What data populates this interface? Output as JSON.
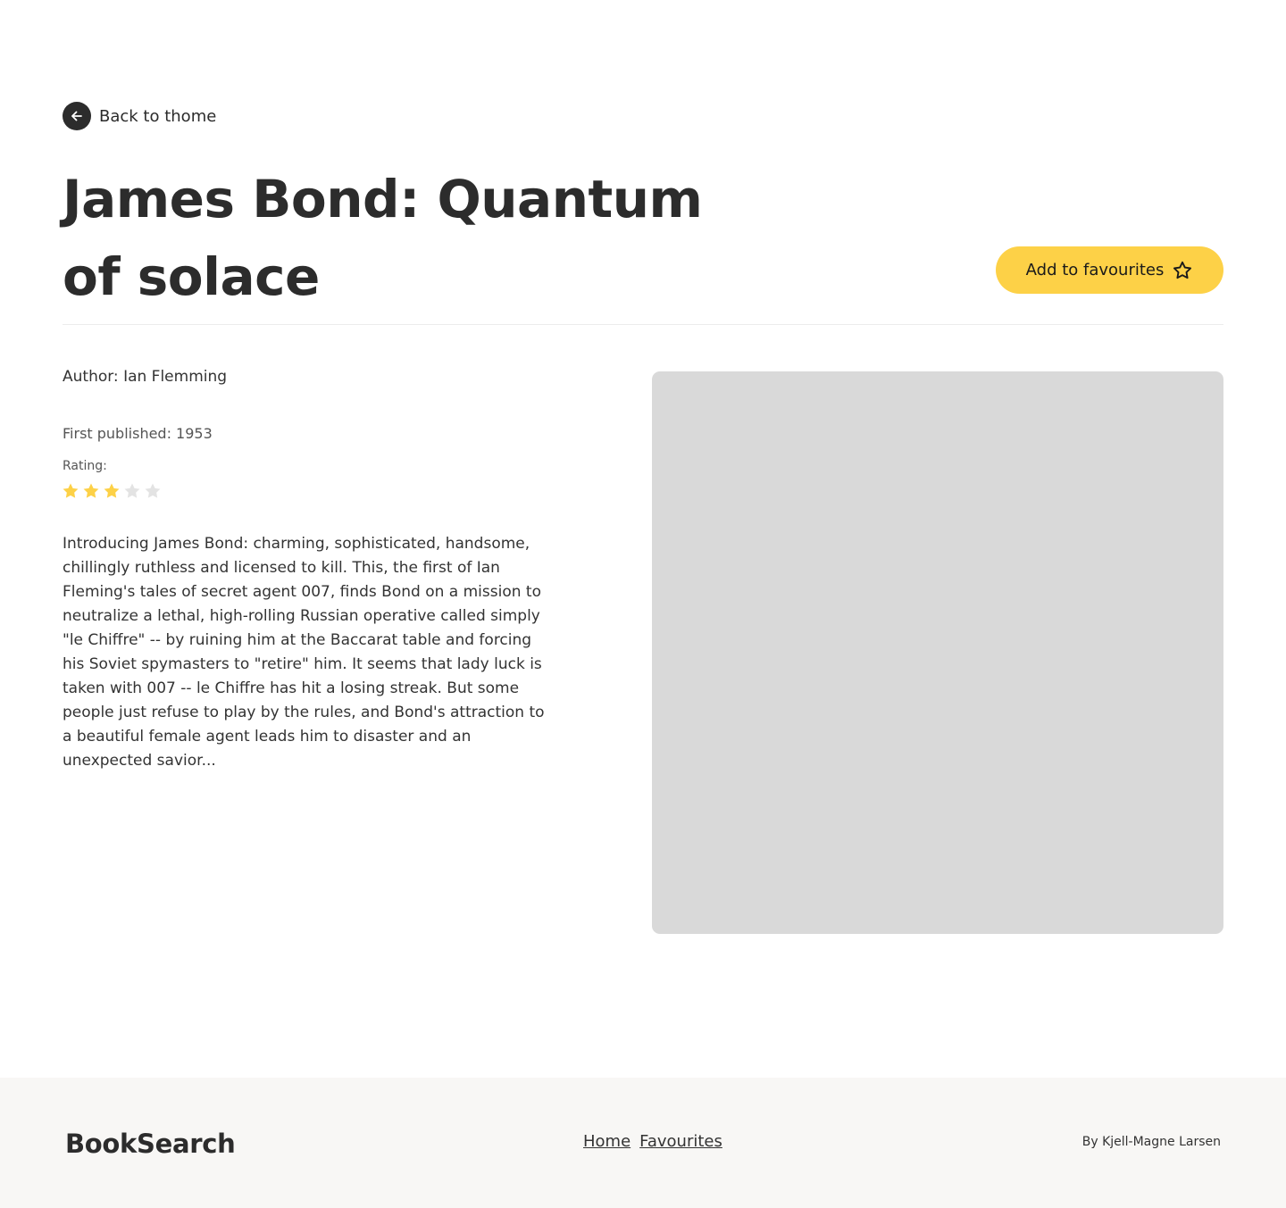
{
  "nav": {
    "back_label": "Back to thome"
  },
  "book": {
    "title": "James Bond: Quantum of solace",
    "author": "Author: Ian Flemming",
    "first_published": "First published: 1953",
    "rating_label": "Rating:",
    "rating_value": 3,
    "rating_max": 5,
    "description": "Introducing James Bond: charming, sophisticated, handsome, chillingly ruthless and licensed to kill. This, the first of Ian Fleming's tales of secret agent 007, finds Bond on a mission to neutralize a lethal, high-rolling Russian operative called simply \"le Chiffre\" -- by ruining him at the Baccarat table and forcing his Soviet spymasters to \"retire\" him. It seems that lady luck is taken with 007 -- le Chiffre has hit a losing streak. But some people just refuse to play by the rules, and Bond's attraction to a beautiful female agent leads him to disaster and an unexpected savior..."
  },
  "actions": {
    "favourite_label": "Add to favourites",
    "favourite_icon": "star-outline-icon"
  },
  "footer": {
    "brand": "BookSearch",
    "links": [
      "Home",
      "Favourites"
    ],
    "credit": "By Kjell-Magne Larsen"
  },
  "colors": {
    "accent": "#fdd147",
    "star_filled": "#fdd147",
    "star_empty": "#e3e3e3",
    "text_dark": "#2c2c2c",
    "cover_placeholder": "#d9d9d9",
    "footer_bg": "#f8f7f5"
  }
}
